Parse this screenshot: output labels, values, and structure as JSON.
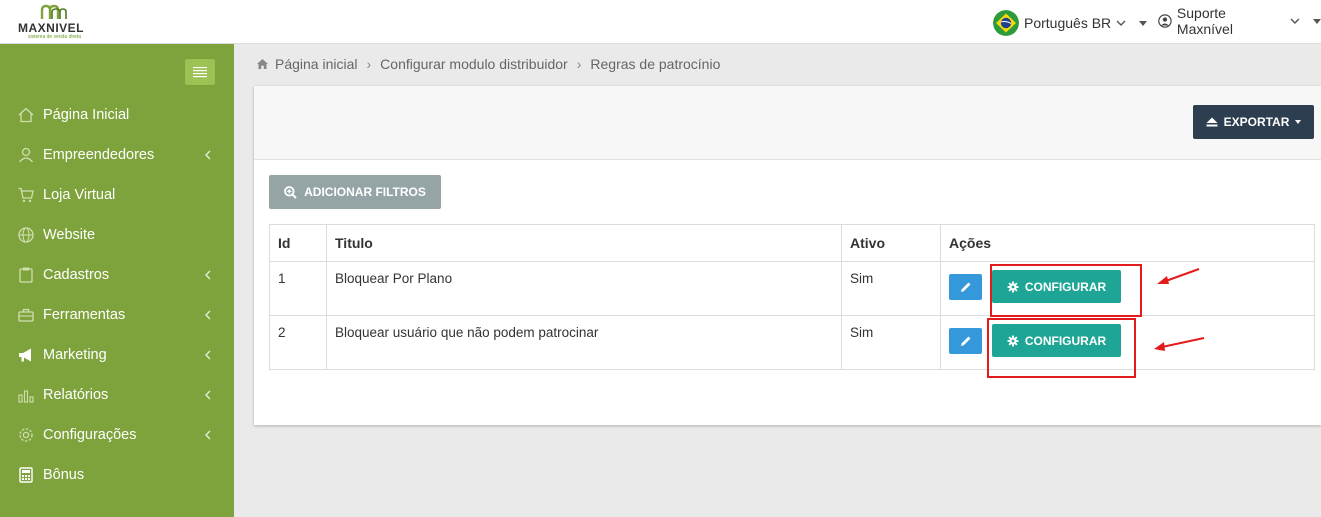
{
  "brand": {
    "name": "MAXNIVEL",
    "tagline": "sistema de venda direta"
  },
  "header": {
    "language": "Português BR",
    "user": "Suporte Maxnível"
  },
  "sidebar": {
    "items": [
      {
        "label": "Página Inicial",
        "icon": "home-icon",
        "has_children": false
      },
      {
        "label": "Empreendedores",
        "icon": "user-icon",
        "has_children": true
      },
      {
        "label": "Loja Virtual",
        "icon": "cart-icon",
        "has_children": false
      },
      {
        "label": "Website",
        "icon": "globe-icon",
        "has_children": false
      },
      {
        "label": "Cadastros",
        "icon": "clipboard-icon",
        "has_children": true
      },
      {
        "label": "Ferramentas",
        "icon": "toolbox-icon",
        "has_children": true
      },
      {
        "label": "Marketing",
        "icon": "megaphone-icon",
        "has_children": true
      },
      {
        "label": "Relatórios",
        "icon": "bar-chart-icon",
        "has_children": true
      },
      {
        "label": "Configurações",
        "icon": "gear-icon",
        "has_children": true
      },
      {
        "label": "Bônus",
        "icon": "calculator-icon",
        "has_children": false
      }
    ]
  },
  "breadcrumb": [
    "Página inicial",
    "Configurar modulo distribuidor",
    "Regras de patrocínio"
  ],
  "toolbar": {
    "export_label": "EXPORTAR",
    "filter_label": "ADICIONAR FILTROS"
  },
  "table": {
    "headers": {
      "id": "Id",
      "title": "Titulo",
      "active": "Ativo",
      "actions": "Ações"
    },
    "rows": [
      {
        "id": "1",
        "title": "Bloquear Por Plano",
        "active": "Sim",
        "config_label": "CONFIGURAR"
      },
      {
        "id": "2",
        "title": "Bloquear usuário que não podem patrocinar",
        "active": "Sim",
        "config_label": "CONFIGURAR"
      }
    ]
  },
  "colors": {
    "sidebar": "#7fa33c",
    "export": "#2c3e50",
    "config": "#1fa595",
    "edit": "#3498db",
    "filter": "#95a5a6",
    "annotation": "#e41b1b"
  }
}
